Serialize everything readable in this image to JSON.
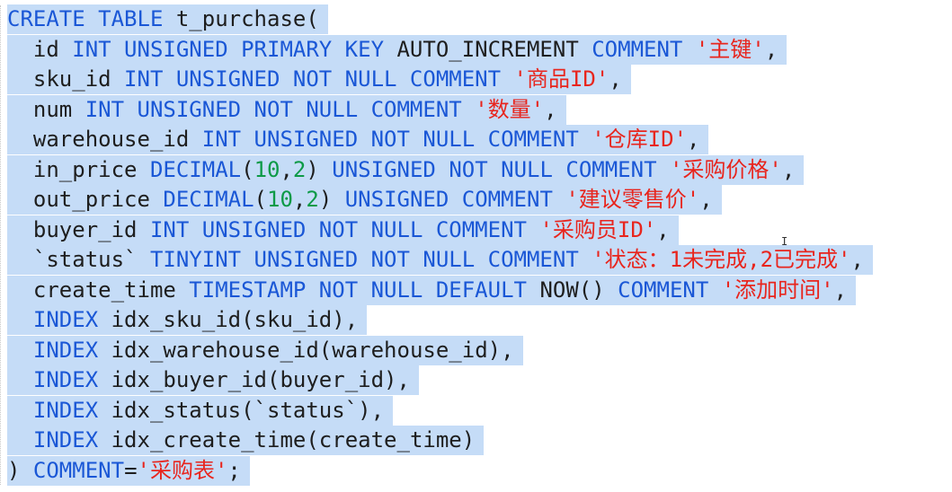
{
  "colors": {
    "keyword": "#1a57d6",
    "identifier": "#1e1e1e",
    "string": "#e8251d",
    "number": "#0d9a47",
    "selection": "#c5dcf7",
    "background": "#ffffff"
  },
  "editor": {
    "cursor_icon": "text-ibeam-cursor-icon",
    "lines": [
      [
        {
          "t": "kw",
          "v": "CREATE TABLE "
        },
        {
          "t": "id",
          "v": "t_purchase("
        }
      ],
      [
        {
          "t": "id",
          "v": "  id "
        },
        {
          "t": "kw",
          "v": "INT UNSIGNED PRIMARY KEY "
        },
        {
          "t": "id",
          "v": "AUTO_INCREMENT "
        },
        {
          "t": "kw",
          "v": "COMMENT "
        },
        {
          "t": "str",
          "v": "'主键'"
        },
        {
          "t": "punc",
          "v": ","
        }
      ],
      [
        {
          "t": "id",
          "v": "  sku_id "
        },
        {
          "t": "kw",
          "v": "INT UNSIGNED NOT NULL COMMENT "
        },
        {
          "t": "str",
          "v": "'商品ID'"
        },
        {
          "t": "punc",
          "v": ","
        }
      ],
      [
        {
          "t": "id",
          "v": "  num "
        },
        {
          "t": "kw",
          "v": "INT UNSIGNED NOT NULL COMMENT "
        },
        {
          "t": "str",
          "v": "'数量'"
        },
        {
          "t": "punc",
          "v": ","
        }
      ],
      [
        {
          "t": "id",
          "v": "  warehouse_id "
        },
        {
          "t": "kw",
          "v": "INT UNSIGNED NOT NULL COMMENT "
        },
        {
          "t": "str",
          "v": "'仓库ID'"
        },
        {
          "t": "punc",
          "v": ","
        }
      ],
      [
        {
          "t": "id",
          "v": "  in_price "
        },
        {
          "t": "kw",
          "v": "DECIMAL"
        },
        {
          "t": "punc",
          "v": "("
        },
        {
          "t": "num",
          "v": "10"
        },
        {
          "t": "punc",
          "v": ","
        },
        {
          "t": "num",
          "v": "2"
        },
        {
          "t": "punc",
          "v": ") "
        },
        {
          "t": "kw",
          "v": "UNSIGNED NOT NULL COMMENT "
        },
        {
          "t": "str",
          "v": "'采购价格'"
        },
        {
          "t": "punc",
          "v": ","
        }
      ],
      [
        {
          "t": "id",
          "v": "  out_price "
        },
        {
          "t": "kw",
          "v": "DECIMAL"
        },
        {
          "t": "punc",
          "v": "("
        },
        {
          "t": "num",
          "v": "10"
        },
        {
          "t": "punc",
          "v": ","
        },
        {
          "t": "num",
          "v": "2"
        },
        {
          "t": "punc",
          "v": ") "
        },
        {
          "t": "kw",
          "v": "UNSIGNED COMMENT "
        },
        {
          "t": "str",
          "v": "'建议零售价'"
        },
        {
          "t": "punc",
          "v": ","
        }
      ],
      [
        {
          "t": "id",
          "v": "  buyer_id "
        },
        {
          "t": "kw",
          "v": "INT UNSIGNED NOT NULL COMMENT "
        },
        {
          "t": "str",
          "v": "'采购员ID'"
        },
        {
          "t": "punc",
          "v": ","
        }
      ],
      [
        {
          "t": "id",
          "v": "  `status` "
        },
        {
          "t": "kw",
          "v": "TINYINT UNSIGNED NOT NULL COMMENT "
        },
        {
          "t": "str",
          "v": "'状态：1未完成,2已完成'"
        },
        {
          "t": "punc",
          "v": ","
        }
      ],
      [
        {
          "t": "id",
          "v": "  create_time "
        },
        {
          "t": "kw",
          "v": "TIMESTAMP NOT NULL DEFAULT "
        },
        {
          "t": "id",
          "v": "NOW() "
        },
        {
          "t": "kw",
          "v": "COMMENT "
        },
        {
          "t": "str",
          "v": "'添加时间'"
        },
        {
          "t": "punc",
          "v": ","
        }
      ],
      [
        {
          "t": "id",
          "v": "  "
        },
        {
          "t": "kw",
          "v": "INDEX "
        },
        {
          "t": "id",
          "v": "idx_sku_id(sku_id),"
        }
      ],
      [
        {
          "t": "id",
          "v": "  "
        },
        {
          "t": "kw",
          "v": "INDEX "
        },
        {
          "t": "id",
          "v": "idx_warehouse_id(warehouse_id),"
        }
      ],
      [
        {
          "t": "id",
          "v": "  "
        },
        {
          "t": "kw",
          "v": "INDEX "
        },
        {
          "t": "id",
          "v": "idx_buyer_id(buyer_id),"
        }
      ],
      [
        {
          "t": "id",
          "v": "  "
        },
        {
          "t": "kw",
          "v": "INDEX "
        },
        {
          "t": "id",
          "v": "idx_status(`status`),"
        }
      ],
      [
        {
          "t": "id",
          "v": "  "
        },
        {
          "t": "kw",
          "v": "INDEX "
        },
        {
          "t": "id",
          "v": "idx_create_time(create_time)"
        }
      ],
      [
        {
          "t": "punc",
          "v": ") "
        },
        {
          "t": "kw",
          "v": "COMMENT"
        },
        {
          "t": "punc",
          "v": "="
        },
        {
          "t": "str",
          "v": "'采购表'"
        },
        {
          "t": "punc",
          "v": ";"
        }
      ]
    ]
  }
}
